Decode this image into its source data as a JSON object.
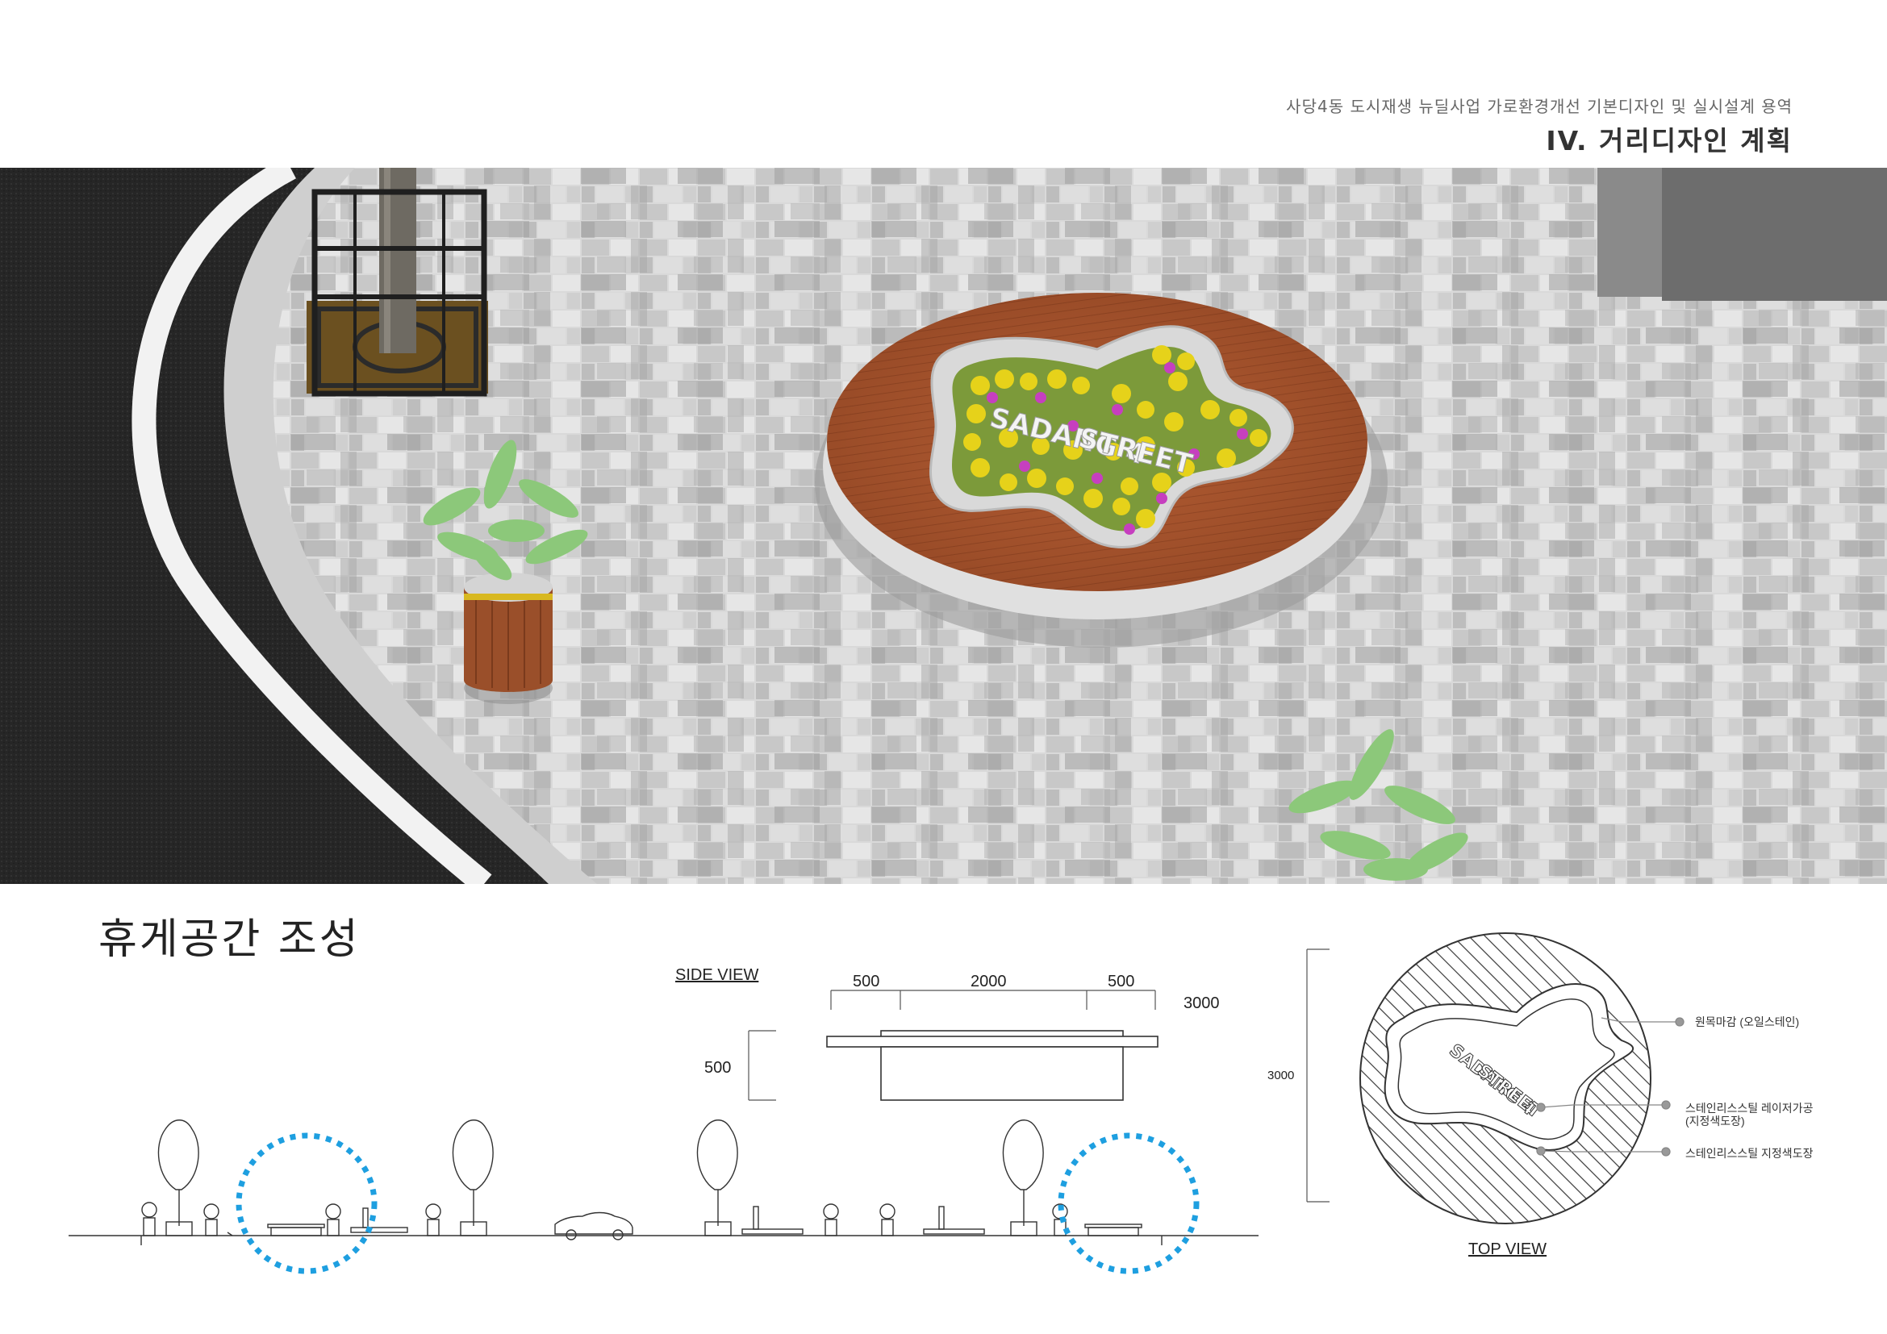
{
  "header": {
    "subtitle": "사당4동 도시재생 뉴딜사업 가로환경개선 기본디자인 및 실시설계 용역",
    "title": "IV. 거리디자인 계획"
  },
  "render": {
    "planter_text_line1": "SADANG 4",
    "planter_text_line2": "STREET"
  },
  "section": {
    "title": "휴게공간 조성"
  },
  "side_view": {
    "label": "SIDE VIEW",
    "dim_left": "500",
    "dim_center": "2000",
    "dim_right": "500",
    "dim_total": "3000",
    "dim_height": "500"
  },
  "top_view": {
    "label": "TOP VIEW",
    "dim_diameter": "3000",
    "plate_text_line1": "SADANG 4",
    "plate_text_line2": "STREET",
    "callouts": [
      "원목마감 (오일스테인)",
      "스테인리스스틸 레이저가공",
      "(지정색도장)",
      "스테인리스스틸 지정색도장"
    ]
  },
  "colors": {
    "highlight_circle": "#1e9fe0",
    "wood": "#a9552e",
    "asphalt": "#2a2a2a"
  }
}
